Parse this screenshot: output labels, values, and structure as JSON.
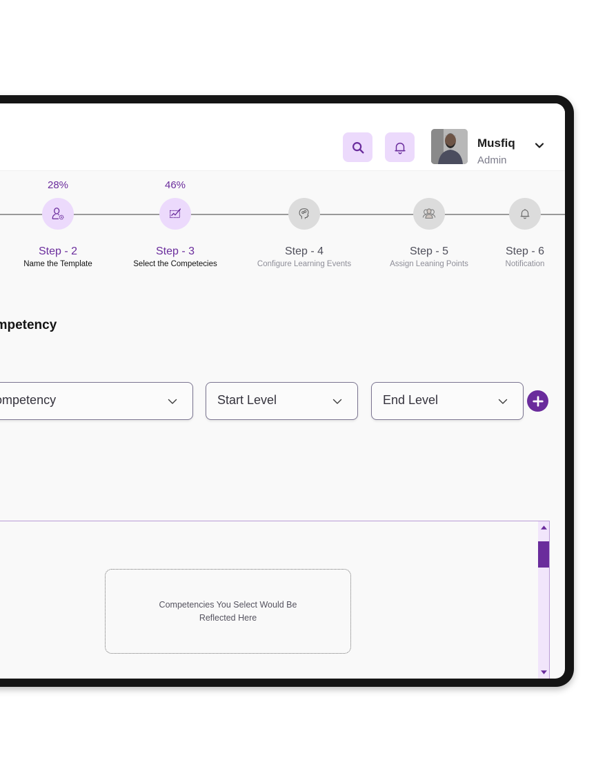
{
  "header": {
    "search_icon": "search-icon",
    "notification_icon": "bell-icon",
    "user": {
      "name": "Musfiq",
      "role": "Admin"
    }
  },
  "stepper": {
    "steps": [
      {
        "percent": "28%",
        "title": "Step - 2",
        "subtitle": "Name the Template",
        "icon": "user-settings-icon",
        "state": "active"
      },
      {
        "percent": "46%",
        "title": "Step - 3",
        "subtitle": "Select the Competecies",
        "icon": "chart-edit-icon",
        "state": "active"
      },
      {
        "percent": "",
        "title": "Step - 4",
        "subtitle": "Configure Learning Events",
        "icon": "brain-icon",
        "state": "inactive"
      },
      {
        "percent": "",
        "title": "Step - 5",
        "subtitle": "Assign Leaning Points",
        "icon": "group-icon",
        "state": "inactive"
      },
      {
        "percent": "",
        "title": "Step - 6",
        "subtitle": "Notification",
        "icon": "bell-icon",
        "state": "inactive"
      }
    ]
  },
  "main": {
    "section_title": "Select Competency",
    "selects": {
      "competency": "Select Competency",
      "start_level": "Start Level",
      "end_level": "End Level"
    },
    "list_placeholder": "Competencies You Select Would Be Reflected Here"
  },
  "colors": {
    "accent": "#6a2c9c",
    "accent_light": "#ecdafc",
    "inactive": "#dcdcdc"
  }
}
